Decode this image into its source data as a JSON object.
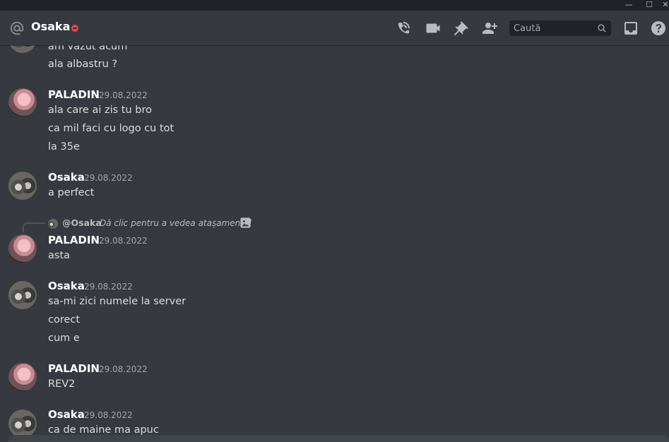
{
  "window": {
    "minimize_glyph": "—",
    "maximize_glyph": "☐",
    "close_glyph": "✕"
  },
  "header": {
    "channel_name": "Osaka",
    "status": "do-not-disturb",
    "icons": [
      "phone-call-icon",
      "video-camera-icon",
      "pin-icon",
      "add-friend-icon",
      "inbox-icon",
      "help-icon"
    ],
    "search": {
      "placeholder": "Caută",
      "value": ""
    }
  },
  "colors": {
    "background": "#36393f",
    "header_bg": "#36393f",
    "titlebar_bg": "#202225",
    "search_bg": "#202225",
    "text": "#dcddde",
    "muted": "#a3a6aa",
    "dnd_red": "#ed4245"
  },
  "messages": {
    "partial_top": [
      "am văzut acum",
      "ala albastru ?"
    ],
    "groups": [
      {
        "author": "PALADIN",
        "timestamp": "29.08.2022",
        "lines": [
          "ala care ai zis tu bro",
          "ca mil faci cu logo cu tot",
          "la 35e"
        ]
      },
      {
        "author": "Osaka",
        "timestamp": "29.08.2022",
        "lines": [
          "a perfect"
        ]
      },
      {
        "author": "PALADIN",
        "timestamp": "29.08.2022",
        "lines": [
          "asta"
        ],
        "reply": {
          "author": "@Osaka",
          "text": "Dă clic pentru a vedea atașamentul"
        }
      },
      {
        "author": "Osaka",
        "timestamp": "29.08.2022",
        "lines": [
          "sa-mi zici numele la server",
          "corect",
          "cum e"
        ]
      },
      {
        "author": "PALADIN",
        "timestamp": "29.08.2022",
        "lines": [
          "REV2"
        ]
      },
      {
        "author": "Osaka",
        "timestamp": "29.08.2022",
        "lines": [
          "ca de maine ma apuc"
        ]
      }
    ]
  }
}
